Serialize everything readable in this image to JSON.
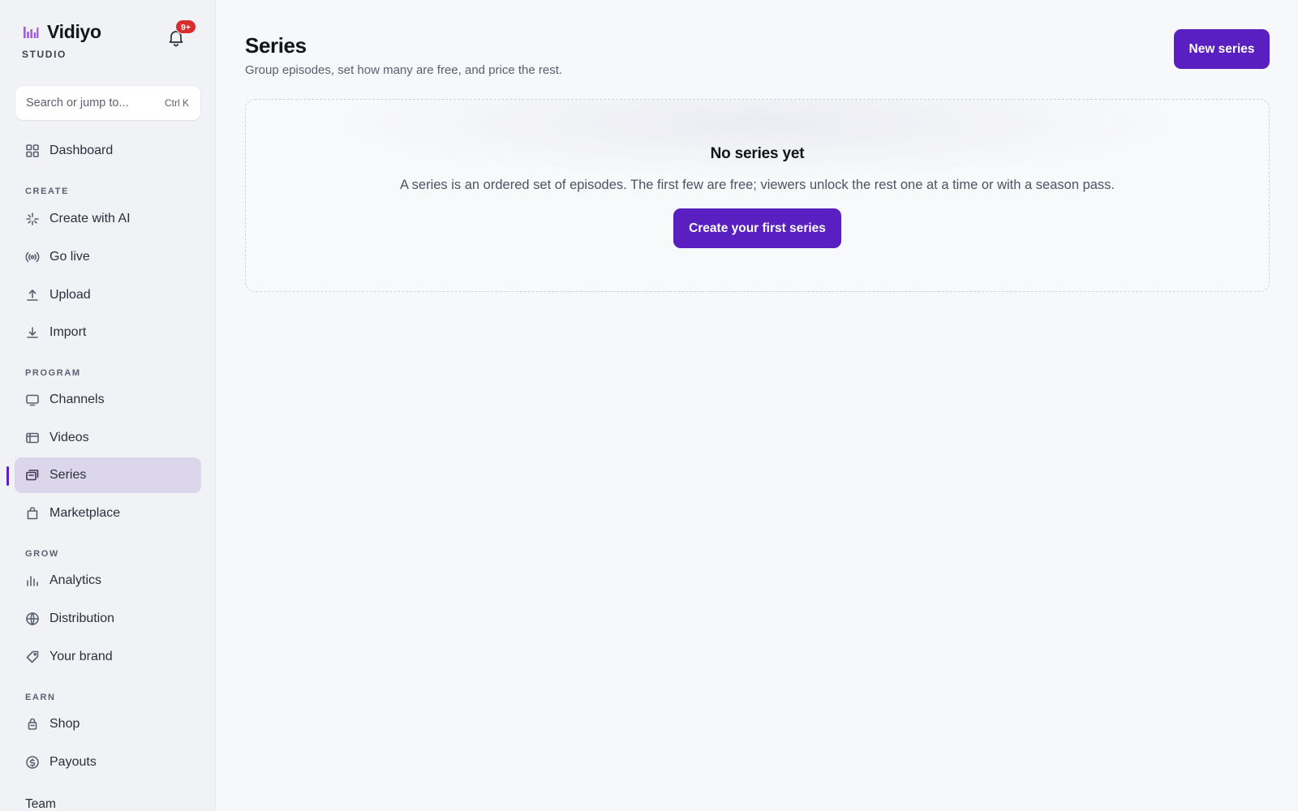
{
  "brand": {
    "name": "Vidiyo",
    "sub": "STUDIO",
    "logo_icon": "bars-logo-icon",
    "accent": "#a855f7"
  },
  "notifications": {
    "icon": "bell-icon",
    "badge": "9+",
    "badge_color": "#d92d2d"
  },
  "search": {
    "placeholder": "Search or jump to...",
    "shortcut": "Ctrl K",
    "icon": "search-input"
  },
  "sidebar": {
    "dashboard": {
      "label": "Dashboard",
      "icon": "grid-icon"
    },
    "sections": {
      "create": "CREATE",
      "program": "PROGRAM",
      "grow": "GROW",
      "earn": "EARN"
    },
    "items": {
      "create_ai": {
        "label": "Create with AI",
        "icon": "sparkle-icon"
      },
      "go_live": {
        "label": "Go live",
        "icon": "broadcast-icon"
      },
      "upload": {
        "label": "Upload",
        "icon": "upload-icon"
      },
      "import": {
        "label": "Import",
        "icon": "download-icon"
      },
      "channels": {
        "label": "Channels",
        "icon": "monitor-icon"
      },
      "videos": {
        "label": "Videos",
        "icon": "video-frame-icon"
      },
      "series": {
        "label": "Series",
        "icon": "stack-icon",
        "active": true
      },
      "marketplace": {
        "label": "Marketplace",
        "icon": "shopping-bag-icon"
      },
      "analytics": {
        "label": "Analytics",
        "icon": "bar-chart-icon"
      },
      "distribution": {
        "label": "Distribution",
        "icon": "globe-icon"
      },
      "your_brand": {
        "label": "Your brand",
        "icon": "tag-icon"
      },
      "shop": {
        "label": "Shop",
        "icon": "shop-bag-icon"
      },
      "payouts": {
        "label": "Payouts",
        "icon": "dollar-circle-icon"
      }
    },
    "team_label": "Team"
  },
  "main": {
    "title": "Series",
    "subtitle": "Group episodes, set how many are free, and price the rest.",
    "new_button": "New series",
    "empty": {
      "title": "No series yet",
      "description": "A series is an ordered set of episodes. The first few are free; viewers unlock the rest one at a time or with a season pass.",
      "cta": "Create your first series"
    }
  },
  "colors": {
    "primary": "#5a1fc0",
    "active_bg": "#dcd6ea",
    "background": "#f7f8fb"
  }
}
